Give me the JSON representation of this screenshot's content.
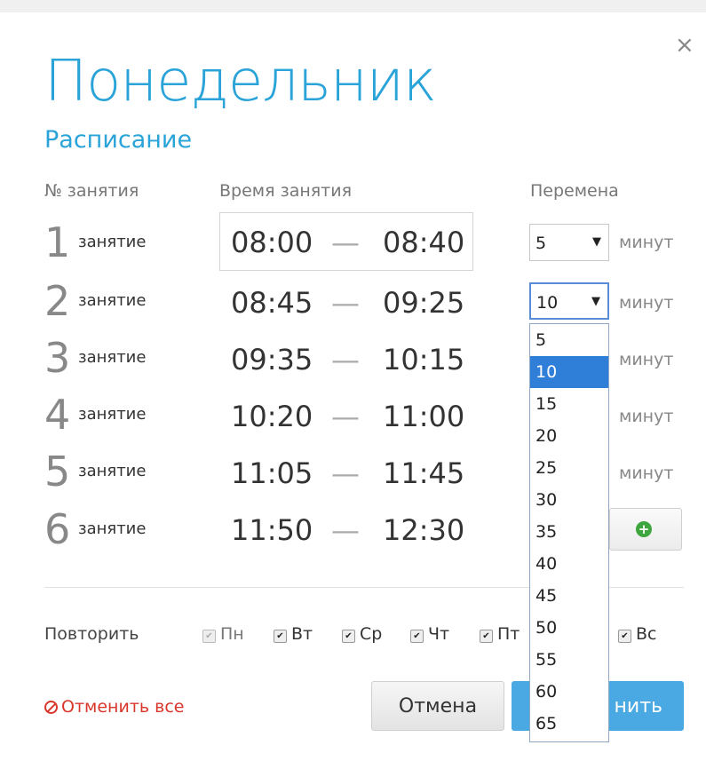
{
  "dialog": {
    "close_glyph": "×",
    "title": "Понедельник",
    "subtitle": "Расписание"
  },
  "headers": {
    "lesson_no": "№ занятия",
    "time": "Время занятия",
    "break": "Перемена"
  },
  "lesson_label": "занятие",
  "dash": "—",
  "minutes_label": "минут",
  "lessons": [
    {
      "num": "1",
      "start": "08:00",
      "end": "08:40",
      "break": "5"
    },
    {
      "num": "2",
      "start": "08:45",
      "end": "09:25",
      "break": "10"
    },
    {
      "num": "3",
      "start": "09:35",
      "end": "10:15"
    },
    {
      "num": "4",
      "start": "10:20",
      "end": "11:00"
    },
    {
      "num": "5",
      "start": "11:05",
      "end": "11:45"
    },
    {
      "num": "6",
      "start": "11:50",
      "end": "12:30"
    }
  ],
  "dropdown": {
    "options": [
      "5",
      "10",
      "15",
      "20",
      "25",
      "30",
      "35",
      "40",
      "45",
      "50",
      "55",
      "60",
      "65"
    ],
    "selected": "10"
  },
  "repeat": {
    "label": "Повторить",
    "days": [
      {
        "label": "Пн",
        "checked": true,
        "disabled": true
      },
      {
        "label": "Вт",
        "checked": true
      },
      {
        "label": "Ср",
        "checked": true
      },
      {
        "label": "Чт",
        "checked": true
      },
      {
        "label": "Пт",
        "checked": true
      },
      {
        "label": "Вс",
        "checked": true
      }
    ]
  },
  "footer": {
    "cancel_all": "Отменить все",
    "cancel": "Отмена",
    "save_visible": "нить"
  },
  "icons": {
    "check": "✔",
    "caret": "▼",
    "plus": "+"
  },
  "colors": {
    "accent": "#2aa3d9",
    "danger": "#d9362b",
    "highlight": "#2f7fd8",
    "add": "#3fa63f"
  }
}
